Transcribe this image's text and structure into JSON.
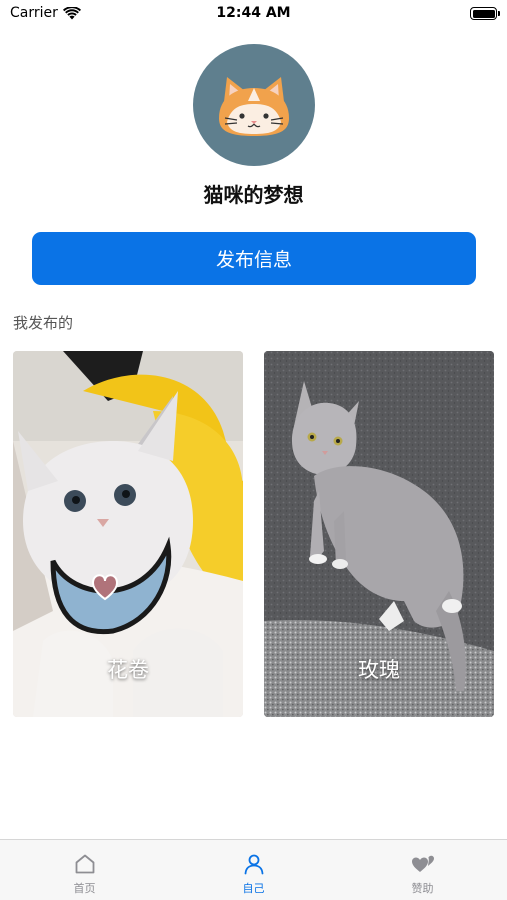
{
  "status_bar": {
    "carrier": "Carrier",
    "time": "12:44 AM"
  },
  "profile": {
    "name": "猫咪的梦想",
    "avatar_icon": "cat-face-icon"
  },
  "publish_button": {
    "label": "发布信息",
    "color": "#0a73e6"
  },
  "section": {
    "title": "我发布的"
  },
  "posts": [
    {
      "name": "花卷"
    },
    {
      "name": "玫瑰"
    }
  ],
  "tab_bar": {
    "active_color": "#0a73e6",
    "tabs": [
      {
        "label": "首页",
        "icon": "home-icon"
      },
      {
        "label": "自己",
        "icon": "person-icon"
      },
      {
        "label": "赞助",
        "icon": "hearts-icon"
      }
    ]
  }
}
